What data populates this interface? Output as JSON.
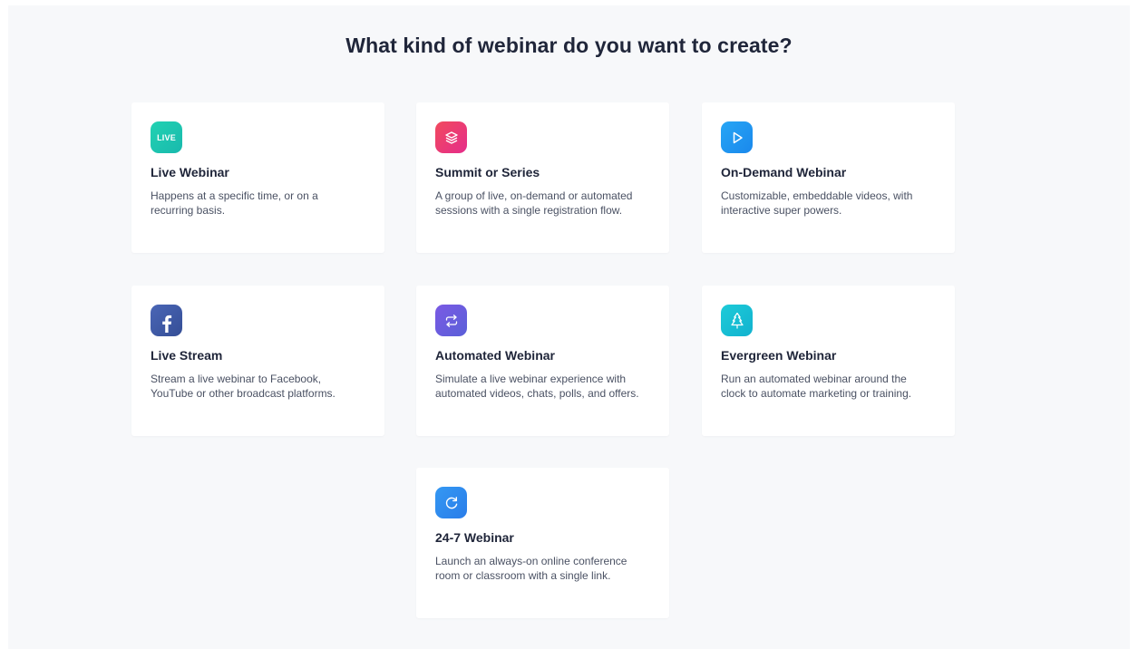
{
  "page": {
    "title": "What kind of webinar do you want to create?"
  },
  "cards": [
    {
      "title": "Live Webinar",
      "description": "Happens at a specific time, or on a recurring basis.",
      "icon": "live-icon",
      "icon_text": "LIVE",
      "icon_color": "#1fc8b0"
    },
    {
      "title": "Summit or Series",
      "description": "A group of live, on-demand or automated sessions with a single registration flow.",
      "icon": "layers-icon",
      "icon_color": "#ef3b6e"
    },
    {
      "title": "On-Demand Webinar",
      "description": "Customizable, embeddable videos, with interactive super powers.",
      "icon": "play-icon",
      "icon_color": "#2199f0"
    },
    {
      "title": "Live Stream",
      "description": "Stream a live webinar to Facebook, YouTube or other broadcast platforms.",
      "icon": "facebook-icon",
      "icon_color": "#3e5aa3"
    },
    {
      "title": "Automated Webinar",
      "description": "Simulate a live webinar experience with automated videos, chats, polls, and offers.",
      "icon": "repeat-icon",
      "icon_color": "#6a5ce0"
    },
    {
      "title": "Evergreen Webinar",
      "description": "Run an automated webinar around the clock to automate marketing or training.",
      "icon": "tree-icon",
      "icon_color": "#16c1d6"
    },
    {
      "title": "24-7 Webinar",
      "description": "Launch an always-on online conference room or classroom with a single link.",
      "icon": "refresh-icon",
      "icon_color": "#2f8af0"
    }
  ]
}
